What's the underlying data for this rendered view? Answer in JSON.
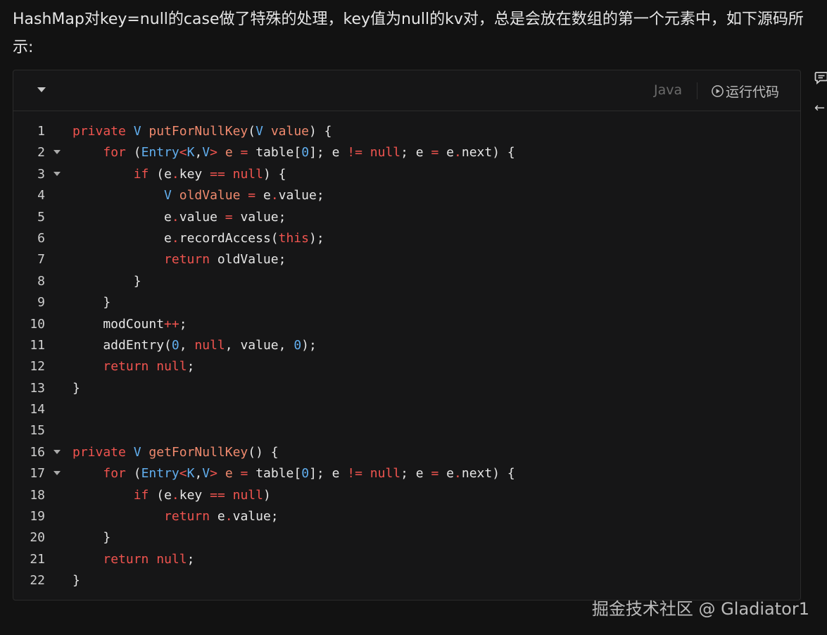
{
  "intro_text": "HashMap对key=null的case做了特殊的处理，key值为null的kv对，总是会放在数组的第一个元素中，如下源码所示:",
  "code_block": {
    "language": "Java",
    "run_label": "运行代码",
    "lines": [
      {
        "n": "1",
        "fold": false,
        "tokens": [
          {
            "t": "private ",
            "c": "kw"
          },
          {
            "t": "V ",
            "c": "ty"
          },
          {
            "t": "putForNullKey",
            "c": "fn"
          },
          {
            "t": "(",
            "c": ""
          },
          {
            "t": "V ",
            "c": "ty"
          },
          {
            "t": "value",
            "c": "fn"
          },
          {
            "t": ") {",
            "c": ""
          }
        ]
      },
      {
        "n": "2",
        "fold": true,
        "tokens": [
          {
            "t": "    ",
            "c": ""
          },
          {
            "t": "for",
            "c": "kw"
          },
          {
            "t": " (",
            "c": ""
          },
          {
            "t": "Entry",
            "c": "ty"
          },
          {
            "t": "<",
            "c": "op"
          },
          {
            "t": "K",
            "c": "ty"
          },
          {
            "t": ",",
            "c": ""
          },
          {
            "t": "V",
            "c": "ty"
          },
          {
            "t": "> ",
            "c": "op"
          },
          {
            "t": "e ",
            "c": "fn"
          },
          {
            "t": "= ",
            "c": "op"
          },
          {
            "t": "table[",
            "c": ""
          },
          {
            "t": "0",
            "c": "num"
          },
          {
            "t": "]; e ",
            "c": ""
          },
          {
            "t": "!= ",
            "c": "op"
          },
          {
            "t": "null",
            "c": "kw"
          },
          {
            "t": "; e ",
            "c": ""
          },
          {
            "t": "= ",
            "c": "op"
          },
          {
            "t": "e",
            "c": ""
          },
          {
            "t": ".",
            "c": "op"
          },
          {
            "t": "next) {",
            "c": ""
          }
        ]
      },
      {
        "n": "3",
        "fold": true,
        "tokens": [
          {
            "t": "        ",
            "c": ""
          },
          {
            "t": "if",
            "c": "kw"
          },
          {
            "t": " (e",
            "c": ""
          },
          {
            "t": ".",
            "c": "op"
          },
          {
            "t": "key ",
            "c": ""
          },
          {
            "t": "== ",
            "c": "op"
          },
          {
            "t": "null",
            "c": "kw"
          },
          {
            "t": ") {",
            "c": ""
          }
        ]
      },
      {
        "n": "4",
        "fold": false,
        "tokens": [
          {
            "t": "            ",
            "c": ""
          },
          {
            "t": "V ",
            "c": "ty"
          },
          {
            "t": "oldValue ",
            "c": "fn"
          },
          {
            "t": "= ",
            "c": "op"
          },
          {
            "t": "e",
            "c": ""
          },
          {
            "t": ".",
            "c": "op"
          },
          {
            "t": "value;",
            "c": ""
          }
        ]
      },
      {
        "n": "5",
        "fold": false,
        "tokens": [
          {
            "t": "            e",
            "c": ""
          },
          {
            "t": ".",
            "c": "op"
          },
          {
            "t": "value ",
            "c": ""
          },
          {
            "t": "= ",
            "c": "op"
          },
          {
            "t": "value;",
            "c": ""
          }
        ]
      },
      {
        "n": "6",
        "fold": false,
        "tokens": [
          {
            "t": "            e",
            "c": ""
          },
          {
            "t": ".",
            "c": "op"
          },
          {
            "t": "recordAccess(",
            "c": ""
          },
          {
            "t": "this",
            "c": "kw"
          },
          {
            "t": ");",
            "c": ""
          }
        ]
      },
      {
        "n": "7",
        "fold": false,
        "tokens": [
          {
            "t": "            ",
            "c": ""
          },
          {
            "t": "return",
            "c": "kw"
          },
          {
            "t": " oldValue;",
            "c": ""
          }
        ]
      },
      {
        "n": "8",
        "fold": false,
        "tokens": [
          {
            "t": "        }",
            "c": ""
          }
        ]
      },
      {
        "n": "9",
        "fold": false,
        "tokens": [
          {
            "t": "    }",
            "c": ""
          }
        ]
      },
      {
        "n": "10",
        "fold": false,
        "tokens": [
          {
            "t": "    modCount",
            "c": ""
          },
          {
            "t": "++",
            "c": "op"
          },
          {
            "t": ";",
            "c": ""
          }
        ]
      },
      {
        "n": "11",
        "fold": false,
        "tokens": [
          {
            "t": "    addEntry(",
            "c": ""
          },
          {
            "t": "0",
            "c": "num"
          },
          {
            "t": ", ",
            "c": ""
          },
          {
            "t": "null",
            "c": "kw"
          },
          {
            "t": ", value, ",
            "c": ""
          },
          {
            "t": "0",
            "c": "num"
          },
          {
            "t": ");",
            "c": ""
          }
        ]
      },
      {
        "n": "12",
        "fold": false,
        "tokens": [
          {
            "t": "    ",
            "c": ""
          },
          {
            "t": "return",
            "c": "kw"
          },
          {
            "t": " ",
            "c": ""
          },
          {
            "t": "null",
            "c": "kw"
          },
          {
            "t": ";",
            "c": ""
          }
        ]
      },
      {
        "n": "13",
        "fold": false,
        "tokens": [
          {
            "t": "}",
            "c": ""
          }
        ]
      },
      {
        "n": "14",
        "fold": false,
        "tokens": []
      },
      {
        "n": "15",
        "fold": false,
        "tokens": []
      },
      {
        "n": "16",
        "fold": true,
        "tokens": [
          {
            "t": "private ",
            "c": "kw"
          },
          {
            "t": "V ",
            "c": "ty"
          },
          {
            "t": "getForNullKey",
            "c": "fn"
          },
          {
            "t": "() {",
            "c": ""
          }
        ]
      },
      {
        "n": "17",
        "fold": true,
        "tokens": [
          {
            "t": "    ",
            "c": ""
          },
          {
            "t": "for",
            "c": "kw"
          },
          {
            "t": " (",
            "c": ""
          },
          {
            "t": "Entry",
            "c": "ty"
          },
          {
            "t": "<",
            "c": "op"
          },
          {
            "t": "K",
            "c": "ty"
          },
          {
            "t": ",",
            "c": ""
          },
          {
            "t": "V",
            "c": "ty"
          },
          {
            "t": "> ",
            "c": "op"
          },
          {
            "t": "e ",
            "c": "fn"
          },
          {
            "t": "= ",
            "c": "op"
          },
          {
            "t": "table[",
            "c": ""
          },
          {
            "t": "0",
            "c": "num"
          },
          {
            "t": "]; e ",
            "c": ""
          },
          {
            "t": "!= ",
            "c": "op"
          },
          {
            "t": "null",
            "c": "kw"
          },
          {
            "t": "; e ",
            "c": ""
          },
          {
            "t": "= ",
            "c": "op"
          },
          {
            "t": "e",
            "c": ""
          },
          {
            "t": ".",
            "c": "op"
          },
          {
            "t": "next) {",
            "c": ""
          }
        ]
      },
      {
        "n": "18",
        "fold": false,
        "tokens": [
          {
            "t": "        ",
            "c": ""
          },
          {
            "t": "if",
            "c": "kw"
          },
          {
            "t": " (e",
            "c": ""
          },
          {
            "t": ".",
            "c": "op"
          },
          {
            "t": "key ",
            "c": ""
          },
          {
            "t": "== ",
            "c": "op"
          },
          {
            "t": "null",
            "c": "kw"
          },
          {
            "t": ")",
            "c": ""
          }
        ]
      },
      {
        "n": "19",
        "fold": false,
        "tokens": [
          {
            "t": "            ",
            "c": ""
          },
          {
            "t": "return",
            "c": "kw"
          },
          {
            "t": " e",
            "c": ""
          },
          {
            "t": ".",
            "c": "op"
          },
          {
            "t": "value;",
            "c": ""
          }
        ]
      },
      {
        "n": "20",
        "fold": false,
        "tokens": [
          {
            "t": "    }",
            "c": ""
          }
        ]
      },
      {
        "n": "21",
        "fold": false,
        "tokens": [
          {
            "t": "    ",
            "c": ""
          },
          {
            "t": "return",
            "c": "kw"
          },
          {
            "t": " ",
            "c": ""
          },
          {
            "t": "null",
            "c": "kw"
          },
          {
            "t": ";",
            "c": ""
          }
        ]
      },
      {
        "n": "22",
        "fold": false,
        "tokens": [
          {
            "t": "}",
            "c": ""
          }
        ]
      }
    ]
  },
  "side_icons": [
    "comment-icon",
    "back-arrow-icon"
  ],
  "watermark": "掘金技术社区 @ Gladiator1",
  "colors": {
    "background": "#121212",
    "keyword": "#f0544f",
    "type": "#61aeee",
    "identifier": "#f08a6e"
  }
}
